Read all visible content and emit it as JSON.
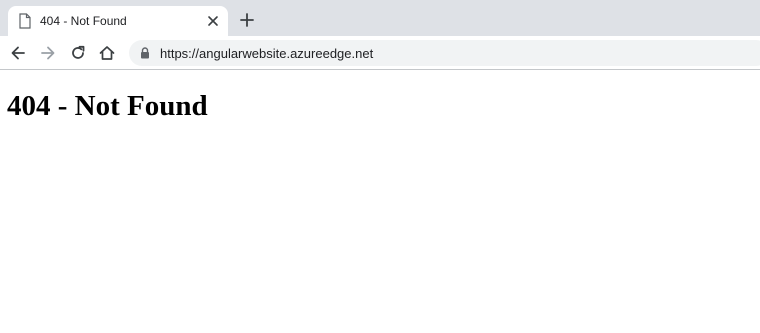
{
  "browser": {
    "tab": {
      "title": "404 - Not Found",
      "favicon_icon": "document-icon",
      "close_icon": "close-icon"
    },
    "new_tab_icon": "plus-icon",
    "toolbar": {
      "back_icon": "arrow-left-icon",
      "forward_icon": "arrow-right-icon",
      "reload_icon": "reload-icon",
      "home_icon": "home-icon"
    },
    "address_bar": {
      "lock_icon": "lock-icon",
      "url": "https://angularwebsite.azureedge.net"
    },
    "colors": {
      "tabstrip_bg": "#dee1e6",
      "omnibox_bg": "#f1f3f4",
      "forward_disabled": "#9aa0a6"
    }
  },
  "page": {
    "heading": "404 - Not Found"
  }
}
